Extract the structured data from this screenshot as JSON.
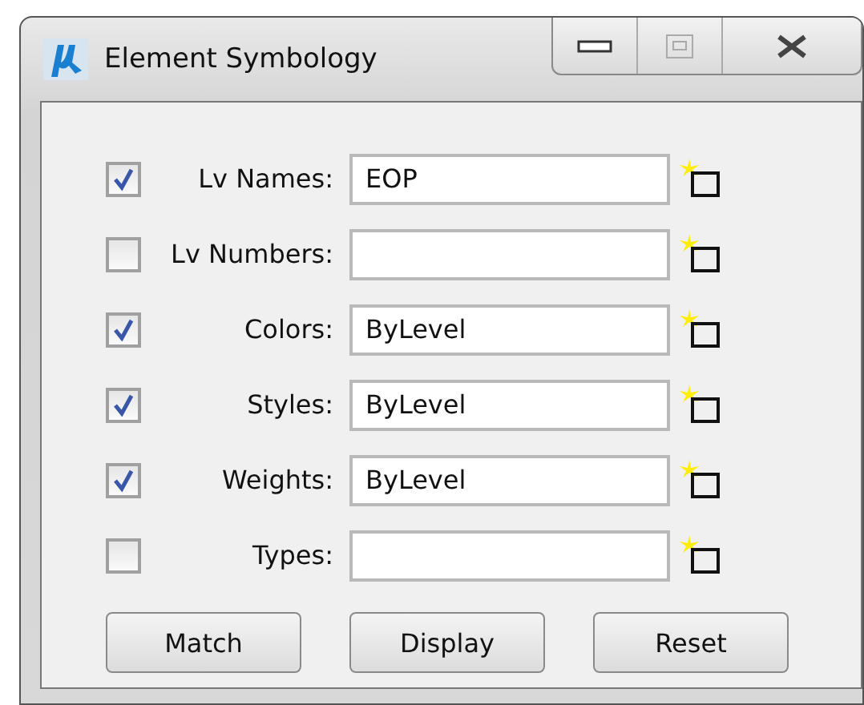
{
  "window": {
    "title": "Element Symbology"
  },
  "rows": [
    {
      "label": "Lv Names:",
      "value": "EOP",
      "checked": true
    },
    {
      "label": "Lv Numbers:",
      "value": "",
      "checked": false
    },
    {
      "label": "Colors:",
      "value": "ByLevel",
      "checked": true
    },
    {
      "label": "Styles:",
      "value": "ByLevel",
      "checked": true
    },
    {
      "label": "Weights:",
      "value": "ByLevel",
      "checked": true
    },
    {
      "label": "Types:",
      "value": "",
      "checked": false
    }
  ],
  "buttons": [
    "Match",
    "Display",
    "Reset"
  ]
}
